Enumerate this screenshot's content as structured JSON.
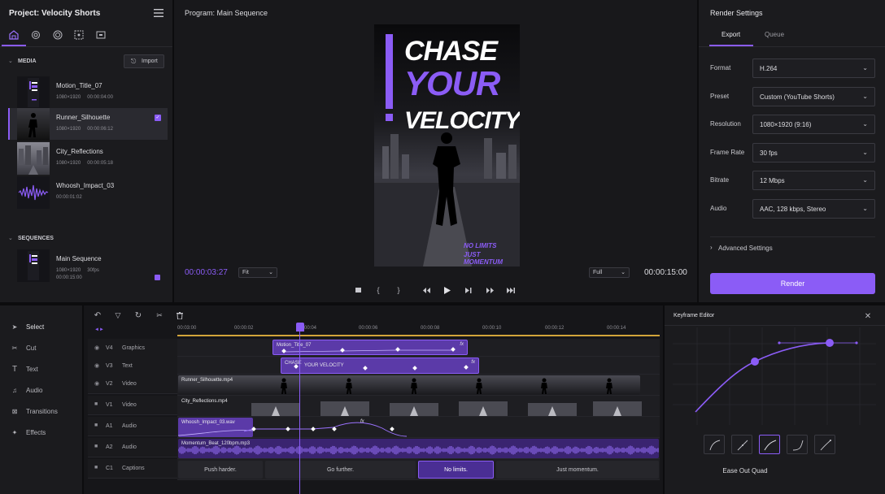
{
  "project": {
    "title": "Project: Velocity Shorts"
  },
  "media": {
    "section_label": "MEDIA",
    "import_label": "Import",
    "items": [
      {
        "name": "Motion_Title_07",
        "resolution": "1080×1920",
        "duration": "00:00:04:00"
      },
      {
        "name": "Runner_Silhouette",
        "resolution": "1080×1920",
        "duration": "00:00:06:12"
      },
      {
        "name": "City_Reflections",
        "resolution": "1080×1920",
        "duration": "00:00:05:18"
      },
      {
        "name": "Whoosh_Impact_03",
        "resolution": "",
        "duration": "00:00:01:02"
      }
    ]
  },
  "sequences": {
    "section_label": "SEQUENCES",
    "items": [
      {
        "name": "Main Sequence",
        "resolution": "1080×1920",
        "fps": "30fps",
        "duration": "00:00:15:00"
      }
    ]
  },
  "program": {
    "title": "Program: Main Sequence",
    "current_time": "00:00:03:27",
    "total_time": "00:00:15:00",
    "fit_label": "Fit",
    "quality_label": "Full",
    "poster": {
      "line1": "CHASE",
      "line2": "YOUR",
      "line3": "VELOCITY",
      "tag1": "NO LIMITS",
      "tag2": "JUST MOMENTUM"
    }
  },
  "render": {
    "title": "Render Settings",
    "tabs": [
      {
        "label": "Export"
      },
      {
        "label": "Queue"
      }
    ],
    "settings": [
      {
        "label": "Format",
        "value": "H.264"
      },
      {
        "label": "Preset",
        "value": "Custom (YouTube Shorts)"
      },
      {
        "label": "Resolution",
        "value": "1080×1920 (9:16)"
      },
      {
        "label": "Frame Rate",
        "value": "30 fps"
      },
      {
        "label": "Bitrate",
        "value": "12 Mbps"
      },
      {
        "label": "Audio",
        "value": "AAC, 128 kbps, Stereo"
      }
    ],
    "advanced_label": "Advanced Settings",
    "render_label": "Render"
  },
  "tools": [
    {
      "label": "Select",
      "icon": "cursor-icon"
    },
    {
      "label": "Cut",
      "icon": "scissors-icon"
    },
    {
      "label": "Text",
      "icon": "text-icon"
    },
    {
      "label": "Audio",
      "icon": "music-icon"
    },
    {
      "label": "Transitions",
      "icon": "transition-icon"
    },
    {
      "label": "Effects",
      "icon": "sparkle-icon"
    }
  ],
  "timeline": {
    "ruler": [
      "00:03:00",
      "00:00:02",
      "00:04",
      "00:00:06",
      "00:00:08",
      "00:00:10",
      "00:00:12",
      "00:00:14"
    ],
    "tracks": [
      {
        "id": "V4",
        "name": "Graphics"
      },
      {
        "id": "V3",
        "name": "Text"
      },
      {
        "id": "V2",
        "name": "Video"
      },
      {
        "id": "V1",
        "name": "Video"
      },
      {
        "id": "A1",
        "name": "Audio"
      },
      {
        "id": "A2",
        "name": "Audio"
      },
      {
        "id": "C1",
        "name": "Captions"
      }
    ],
    "clips": {
      "motion_title": "Motion_Title_07",
      "text_prefix": "CHASE",
      "text_clip": "YOUR VELOCITY",
      "runner": "Runner_Silhouette.mp4",
      "city": "City_Reflections.mp4",
      "whoosh": "Whoosh_Impact_03.wav",
      "music": "Momentum_Beat_120bpm.mp3",
      "fx_label": "fx"
    },
    "captions": [
      "Push harder.",
      "Go further.",
      "No limits.",
      "Just momentum."
    ]
  },
  "keyframe": {
    "title": "Keyframe Editor",
    "ease_label": "Ease Out Quad"
  },
  "colors": {
    "accent": "#8b5cf6",
    "bg": "#111113",
    "panel": "#1b1b1e"
  }
}
